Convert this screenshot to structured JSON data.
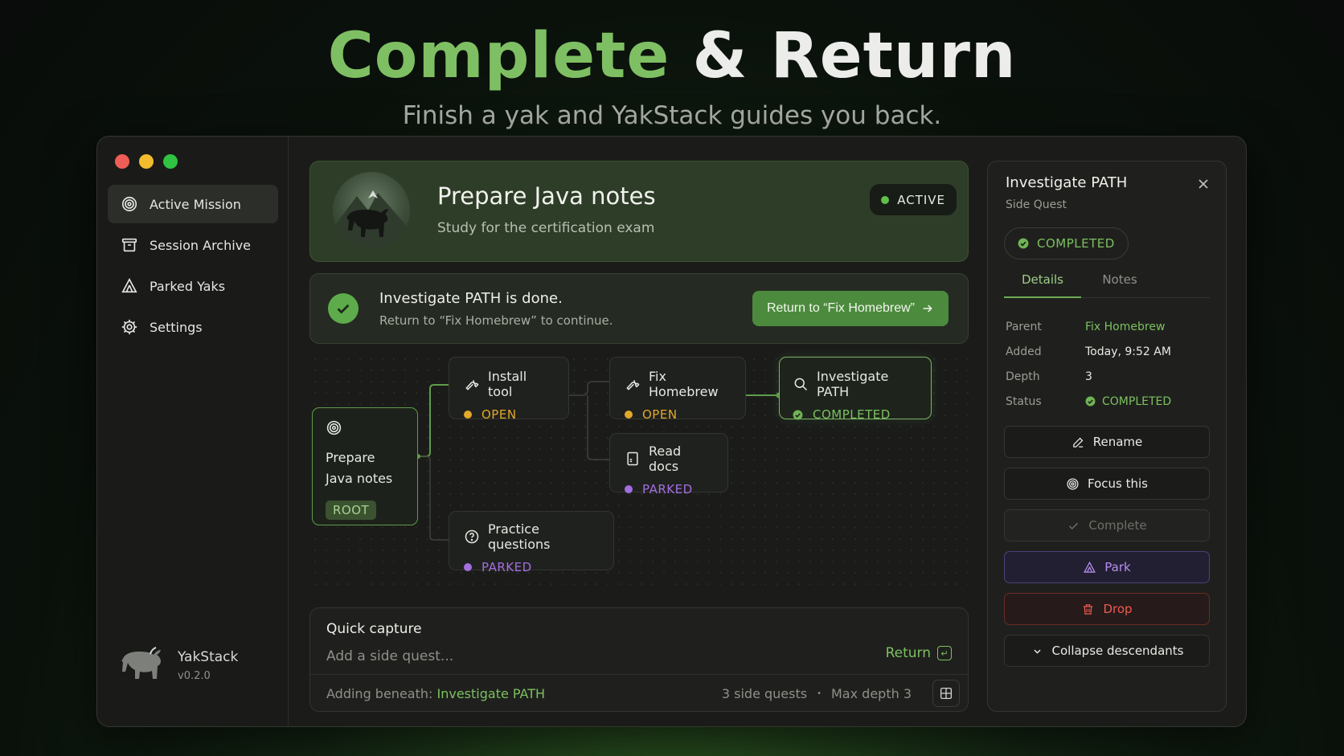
{
  "hero": {
    "title_part1": "Complete",
    "title_part2": "& Return",
    "subtitle": "Finish a yak and YakStack guides you back."
  },
  "sidebar": {
    "items": [
      {
        "label": "Active Mission",
        "icon": "target-icon",
        "active": true
      },
      {
        "label": "Session Archive",
        "icon": "archive-icon",
        "active": false
      },
      {
        "label": "Parked Yaks",
        "icon": "tent-icon",
        "active": false
      },
      {
        "label": "Settings",
        "icon": "gear-icon",
        "active": false
      }
    ],
    "brand": {
      "name": "YakStack",
      "version": "v0.2.0"
    }
  },
  "mission": {
    "title": "Prepare Java notes",
    "subtitle": "Study for the certification exam",
    "status": "ACTIVE"
  },
  "done_banner": {
    "title": "Investigate PATH is done.",
    "subtitle": "Return to “Fix Homebrew” to continue.",
    "button": "Return to “Fix Homebrew”"
  },
  "graph": {
    "root": {
      "title_line1": "Prepare",
      "title_line2": "Java notes",
      "badge": "ROOT"
    },
    "nodes": [
      {
        "id": "install",
        "title": "Install tool",
        "status": "OPEN",
        "icon": "wrench-icon"
      },
      {
        "id": "fixbrew",
        "title": "Fix Homebrew",
        "status": "OPEN",
        "icon": "wrench-icon"
      },
      {
        "id": "investigate",
        "title": "Investigate PATH",
        "status": "COMPLETED",
        "icon": "search-icon"
      },
      {
        "id": "readdocs",
        "title": "Read docs",
        "status": "PARKED",
        "icon": "document-icon"
      },
      {
        "id": "practice",
        "title": "Practice questions",
        "status": "PARKED",
        "icon": "question-icon"
      }
    ]
  },
  "capture": {
    "title": "Quick capture",
    "placeholder": "Add a side quest...",
    "return_label": "Return",
    "adding_prefix": "Adding beneath:",
    "adding_target": "Investigate PATH",
    "side_quests": "3 side quests",
    "separator": "•",
    "max_depth": "Max depth 3"
  },
  "detail": {
    "title": "Investigate PATH",
    "type": "Side Quest",
    "status": "COMPLETED",
    "tabs": [
      "Details",
      "Notes"
    ],
    "rows": [
      {
        "key": "Parent",
        "value": "Fix Homebrew"
      },
      {
        "key": "Added",
        "value": "Today, 9:52 AM"
      },
      {
        "key": "Depth",
        "value": "3"
      },
      {
        "key": "Status",
        "value": "COMPLETED"
      }
    ],
    "actions": {
      "rename": "Rename",
      "focus": "Focus this",
      "complete": "Complete",
      "park": "Park",
      "drop": "Drop",
      "collapse": "Collapse descendants"
    }
  },
  "colors": {
    "accent_green": "#7cc060",
    "open": "#e2a82b",
    "parked": "#a36ee0",
    "drop": "#ee5a50"
  }
}
